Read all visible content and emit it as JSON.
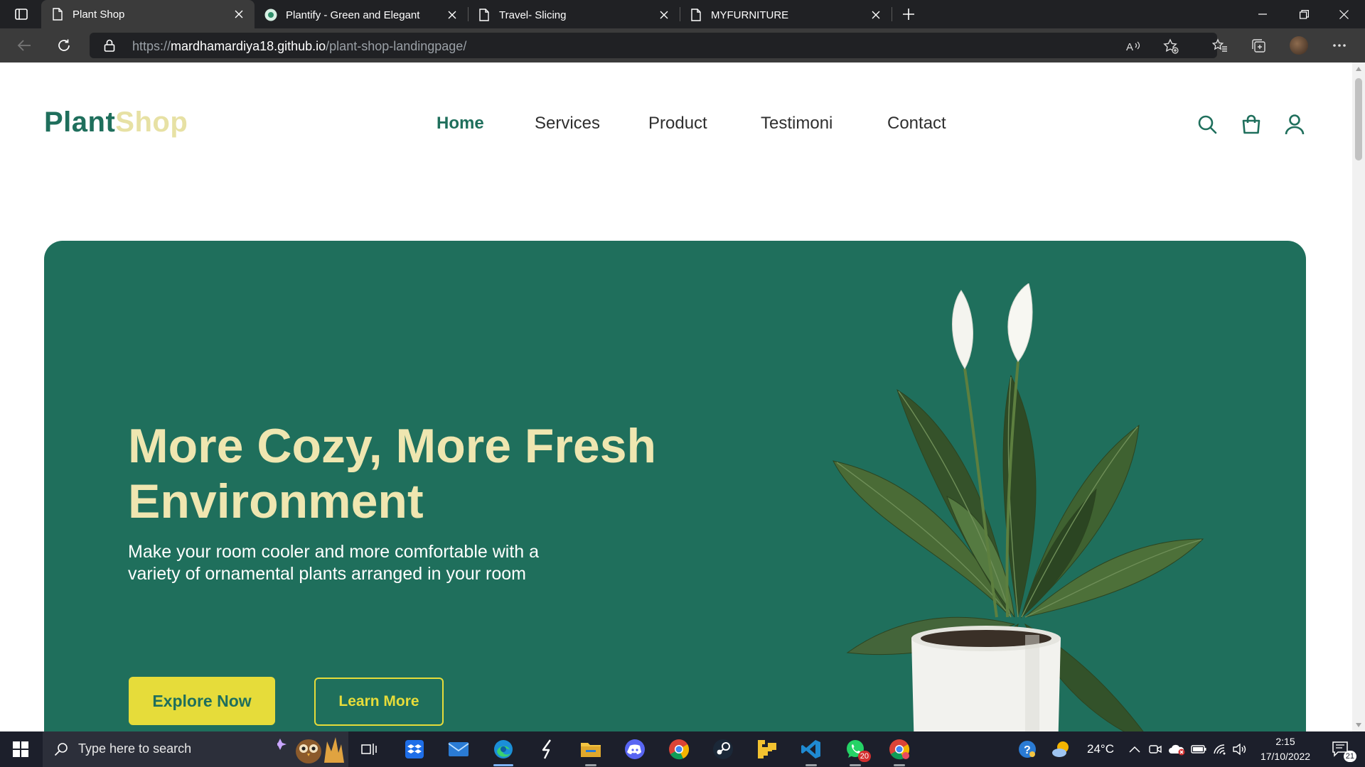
{
  "browser": {
    "tabs": [
      {
        "title": "Plant Shop",
        "active": true,
        "icon": "page-icon"
      },
      {
        "title": "Plantify - Green and Elegant",
        "active": false,
        "icon": "plantify-favicon"
      },
      {
        "title": "Travel- Slicing",
        "active": false,
        "icon": "page-icon"
      },
      {
        "title": "MYFURNITURE",
        "active": false,
        "icon": "page-icon"
      }
    ],
    "url_prefix": "https://",
    "url_host": "mardhamardiya18.github.io",
    "url_path": "/plant-shop-landingpage/"
  },
  "site": {
    "logo_part1": "Plant",
    "logo_part2": "Shop",
    "nav": [
      "Home",
      "Services",
      "Product",
      "Testimoni",
      "Contact"
    ],
    "active_nav": "Home",
    "header_icons": [
      "search-icon",
      "shopping-bag-icon",
      "user-icon"
    ]
  },
  "hero": {
    "title_line1": "More Cozy, More Fresh",
    "title_line2": "Environment",
    "subtitle_line1": "Make your room cooler and more comfortable with a",
    "subtitle_line2": "variety of ornamental plants arranged in your room",
    "primary_button": "Explore Now",
    "secondary_button": "Learn More"
  },
  "taskbar": {
    "search_placeholder": "Type here to search",
    "apps": [
      "task-view",
      "dropbox",
      "mail",
      "edge",
      "app-s",
      "file-explorer",
      "discord",
      "chrome",
      "steam",
      "app-yellow",
      "vscode",
      "whatsapp",
      "chrome-profile"
    ],
    "whatsapp_badge": "20",
    "weather": "24°C",
    "time": "2:15",
    "date": "17/10/2022",
    "notifications": "21"
  },
  "colors": {
    "brand_green": "#1f6f5c",
    "brand_cream": "#efe6b0",
    "accent_yellow": "#e6dc3a"
  }
}
